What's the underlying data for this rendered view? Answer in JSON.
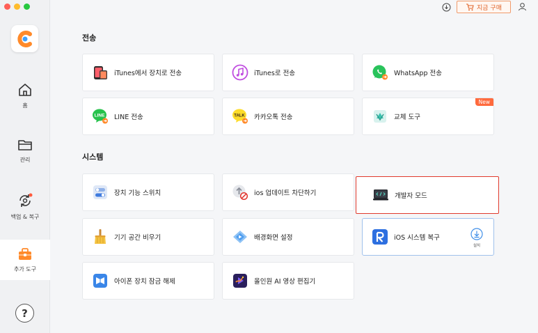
{
  "sidebar": {
    "items": [
      {
        "label": "홈",
        "icon": "home-icon"
      },
      {
        "label": "관리",
        "icon": "folder-icon"
      },
      {
        "label": "백업 & 복구",
        "icon": "backup-restore-icon"
      },
      {
        "label": "추가 도구",
        "icon": "toolbox-icon",
        "active": true
      }
    ],
    "help_label": "?"
  },
  "topbar": {
    "buy_label": "지금 구매"
  },
  "sections": {
    "transfer": {
      "title": "전송",
      "cards": [
        {
          "label": "iTunes에서 장치로 전송",
          "icon": "itunes-to-device-icon"
        },
        {
          "label": "iTunes로 전송",
          "icon": "itunes-icon"
        },
        {
          "label": "WhatsApp 전송",
          "icon": "whatsapp-icon"
        },
        {
          "label": "LINE 전송",
          "icon": "line-icon"
        },
        {
          "label": "카카오톡 전송",
          "icon": "kakaotalk-icon"
        },
        {
          "label": "교체 도구",
          "icon": "switch-tool-icon",
          "badge": "New"
        }
      ]
    },
    "system": {
      "title": "시스템",
      "cards": [
        {
          "label": "장치 기능 스위치",
          "icon": "toggle-switch-icon"
        },
        {
          "label": "ios 업데이트 차단하기",
          "icon": "block-update-icon"
        },
        {
          "label": "개발자 모드",
          "icon": "developer-mode-icon"
        },
        {
          "label": "기기 공간 비우기",
          "icon": "broom-icon"
        },
        {
          "label": "배경화면 설정",
          "icon": "wallpaper-icon"
        },
        {
          "label": "iOS 시스템 복구",
          "icon": "ios-repair-icon",
          "install_label": "설치"
        },
        {
          "label": "아이폰 장치 잠금 해제",
          "icon": "unlock-icon"
        },
        {
          "label": "올인원 AI 영상 편집기",
          "icon": "ai-video-icon"
        }
      ]
    }
  },
  "colors": {
    "accent": "#1a73e8",
    "highlight": "#e03a2c",
    "buy": "#e0642a",
    "badge": "#ff6a3d"
  }
}
